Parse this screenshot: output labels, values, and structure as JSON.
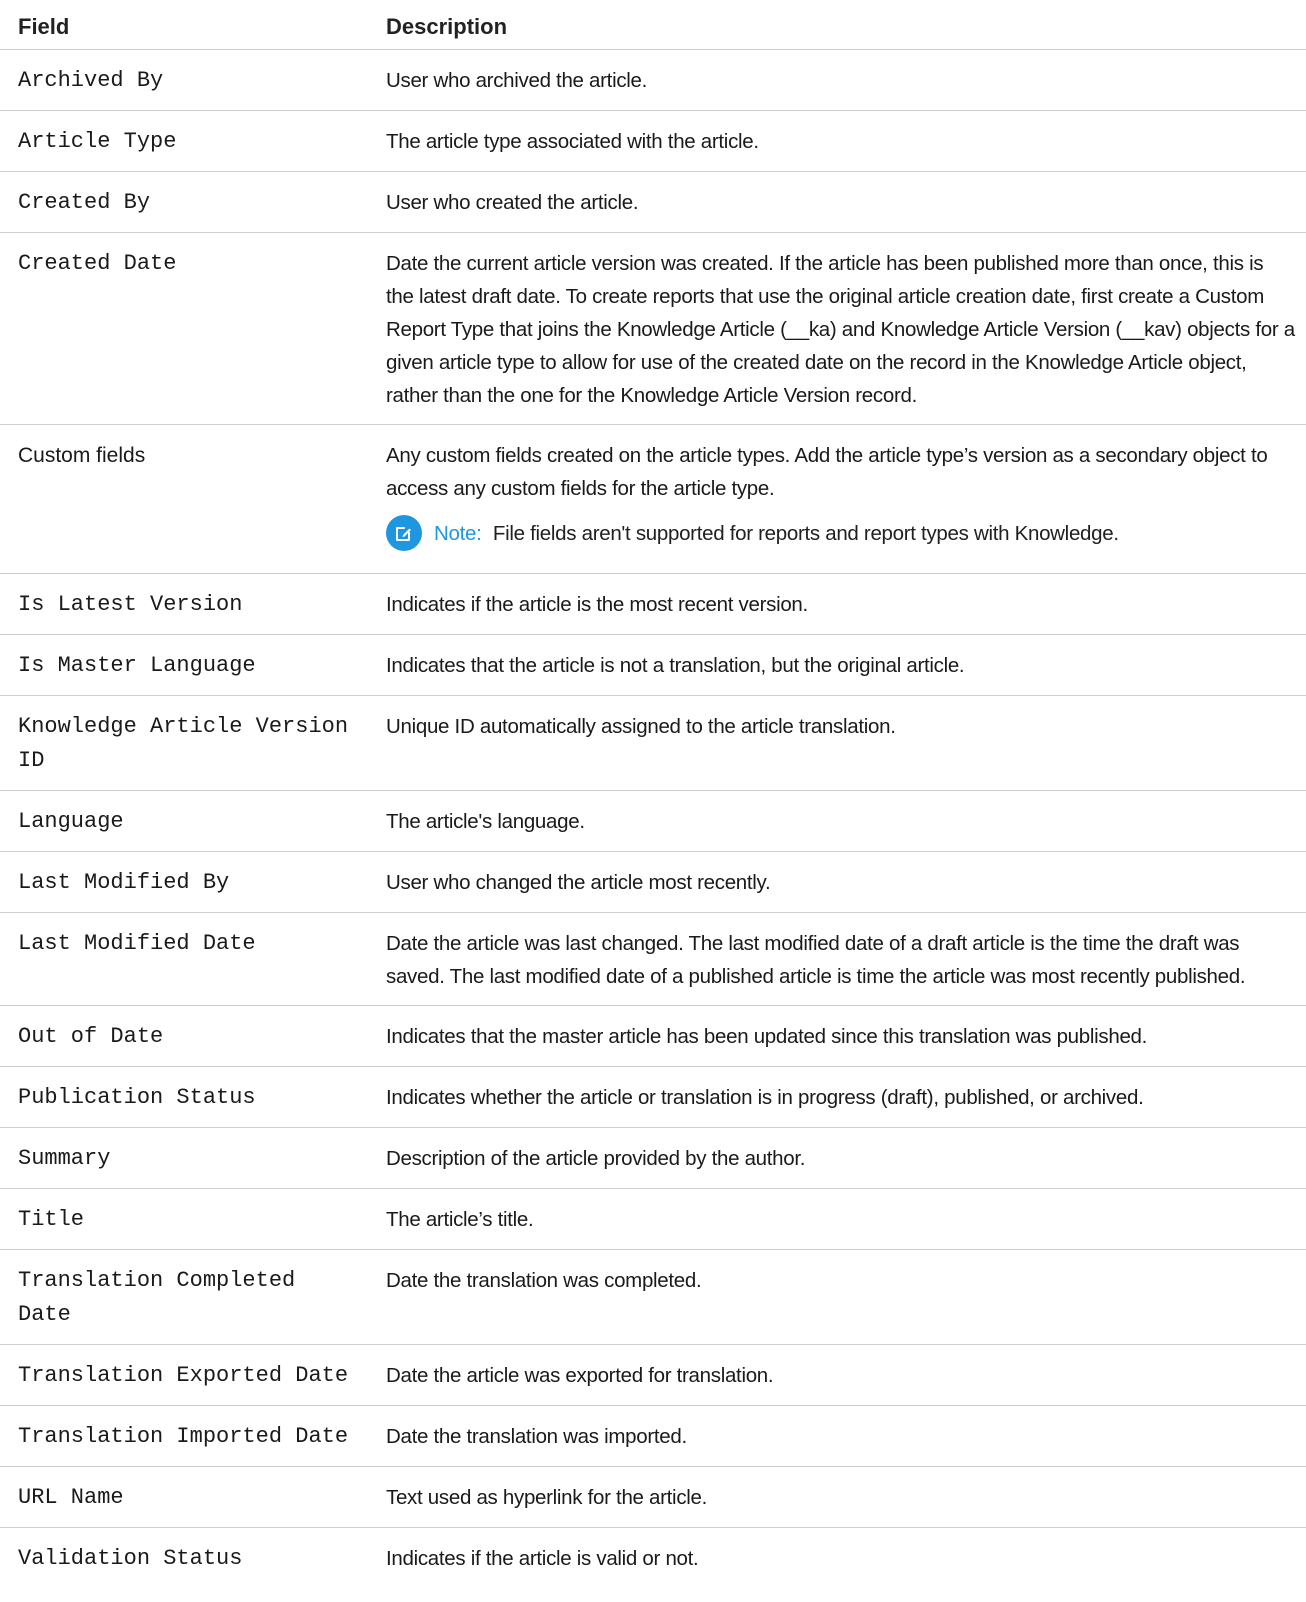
{
  "header": {
    "field": "Field",
    "description": "Description"
  },
  "rows": [
    {
      "field": "Archived By",
      "description": "User who archived the article."
    },
    {
      "field": "Article Type",
      "description": "The article type associated with the article."
    },
    {
      "field": "Created By",
      "description": "User who created the article."
    },
    {
      "field": "Created Date",
      "description": "Date the current article version was created. If the article has been published more than once, this is the latest draft date. To create reports that use the original article creation date, first create a Custom Report Type that joins the Knowledge Article (__ka) and Knowledge Article Version (__kav) objects for a given article type to allow for use of the created date on the record in the Knowledge Article object, rather than the one for the Knowledge Article Version record."
    },
    {
      "field": "Custom fields",
      "description": "Any custom fields created on the article types. Add the article type’s version as a secondary object to access any custom fields for the article type.",
      "note_label": "Note:",
      "note_text": "File fields aren't supported for reports and report types with Knowledge."
    },
    {
      "field": "Is Latest Version",
      "description": "Indicates if the article is the most recent version."
    },
    {
      "field": "Is Master Language",
      "description": "Indicates that the article is not a translation, but the original article."
    },
    {
      "field": "Knowledge Article Version ID",
      "description": "Unique ID automatically assigned to the article translation."
    },
    {
      "field": "Language",
      "description": "The article's language."
    },
    {
      "field": "Last Modified By",
      "description": "User who changed the article most recently."
    },
    {
      "field": "Last Modified Date",
      "description": "Date the article was last changed. The last modified date of a draft article is the time the draft was saved. The last modified date of a published article is time the article was most recently published."
    },
    {
      "field": "Out of Date",
      "description": "Indicates that the master article has been updated since this translation was published."
    },
    {
      "field": "Publication Status",
      "description": "Indicates whether the article or translation is in progress (draft), published, or archived."
    },
    {
      "field": "Summary",
      "description": "Description of the article provided by the author."
    },
    {
      "field": "Title",
      "description": "The article’s title."
    },
    {
      "field": "Translation Completed Date",
      "description": "Date the translation was completed."
    },
    {
      "field": "Translation Exported Date",
      "description": "Date the article was exported for translation."
    },
    {
      "field": "Translation Imported Date",
      "description": "Date the translation was imported."
    },
    {
      "field": "URL Name",
      "description": "Text used as hyperlink for the article."
    },
    {
      "field": "Validation Status",
      "description": "Indicates if the article is valid or not."
    }
  ],
  "colors": {
    "note_accent": "#1f97e0",
    "divider": "#cfcfcf"
  },
  "icons": {
    "note": "edit-note-icon"
  }
}
